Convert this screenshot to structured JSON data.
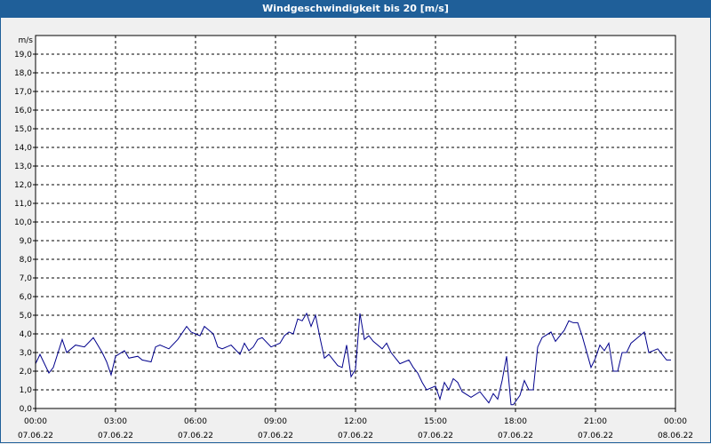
{
  "window": {
    "title": "Windgeschwindigkeit bis 20 [m/s]"
  },
  "chart_data": {
    "type": "line",
    "title": "Windgeschwindigkeit bis 20 [m/s]",
    "ylabel": "m/s",
    "ylim": [
      0,
      20
    ],
    "yticks": [
      "0,0",
      "1,0",
      "2,0",
      "3,0",
      "4,0",
      "5,0",
      "6,0",
      "7,0",
      "8,0",
      "9,0",
      "10,0",
      "11,0",
      "12,0",
      "13,0",
      "14,0",
      "15,0",
      "16,0",
      "17,0",
      "18,0",
      "19,0"
    ],
    "xlim": [
      "07.06.22 00:00",
      "08.06.22 00:00"
    ],
    "xticks": [
      {
        "time": "00:00",
        "date": "07.06.22"
      },
      {
        "time": "03:00",
        "date": "07.06.22"
      },
      {
        "time": "06:00",
        "date": "07.06.22"
      },
      {
        "time": "09:00",
        "date": "07.06.22"
      },
      {
        "time": "12:00",
        "date": "07.06.22"
      },
      {
        "time": "15:00",
        "date": "07.06.22"
      },
      {
        "time": "18:00",
        "date": "07.06.22"
      },
      {
        "time": "21:00",
        "date": "07.06.22"
      },
      {
        "time": "00:00",
        "date": "08.06.22"
      }
    ],
    "grid": true,
    "line_color": "#00008b",
    "series": [
      {
        "x": [
          "00:00",
          "00:10",
          "00:30",
          "00:40",
          "01:00",
          "01:10",
          "01:30",
          "01:50",
          "02:10",
          "02:30",
          "02:40",
          "02:50",
          "03:00",
          "03:20",
          "03:30",
          "03:50",
          "04:00",
          "04:20",
          "04:30",
          "04:40",
          "05:00",
          "05:20",
          "05:40",
          "05:50",
          "06:00",
          "06:10",
          "06:20",
          "06:40",
          "06:50",
          "07:00",
          "07:20",
          "07:40",
          "07:50",
          "08:00",
          "08:10",
          "08:20",
          "08:30",
          "08:50",
          "09:10",
          "09:20",
          "09:30",
          "09:40",
          "09:50",
          "10:00",
          "10:10",
          "10:20",
          "10:30",
          "10:40",
          "10:50",
          "11:00",
          "11:20",
          "11:30",
          "11:40",
          "11:50",
          "12:00",
          "12:10",
          "12:20",
          "12:30",
          "12:40",
          "13:00",
          "13:10",
          "13:20",
          "13:40",
          "14:00",
          "14:10",
          "14:20",
          "14:30",
          "14:40",
          "15:00",
          "15:10",
          "15:20",
          "15:30",
          "15:40",
          "15:50",
          "16:00",
          "16:20",
          "16:40",
          "17:00",
          "17:10",
          "17:20",
          "17:30",
          "17:40",
          "17:50",
          "17:55",
          "18:10",
          "18:20",
          "18:30",
          "18:40",
          "18:50",
          "19:00",
          "19:20",
          "19:30",
          "19:50",
          "20:00",
          "20:10",
          "20:20",
          "20:30",
          "20:50",
          "21:00",
          "21:10",
          "21:20",
          "21:30",
          "21:40",
          "21:50",
          "22:00",
          "22:10",
          "22:20",
          "22:50",
          "23:00",
          "23:10",
          "23:20",
          "23:40",
          "23:50"
        ],
        "y": [
          2.4,
          2.9,
          1.9,
          2.2,
          3.7,
          3.0,
          3.4,
          3.3,
          3.8,
          3.0,
          2.5,
          1.8,
          2.8,
          3.1,
          2.7,
          2.8,
          2.6,
          2.5,
          3.3,
          3.4,
          3.2,
          3.7,
          4.4,
          4.1,
          4.0,
          3.9,
          4.4,
          4.0,
          3.3,
          3.2,
          3.4,
          2.9,
          3.5,
          3.1,
          3.3,
          3.7,
          3.8,
          3.3,
          3.5,
          3.9,
          4.1,
          4.0,
          4.8,
          4.7,
          5.1,
          4.4,
          5.0,
          3.8,
          2.7,
          2.9,
          2.3,
          2.2,
          3.4,
          1.7,
          2.1,
          5.1,
          3.7,
          3.9,
          3.6,
          3.2,
          3.5,
          3.0,
          2.4,
          2.6,
          2.2,
          1.9,
          1.4,
          1.0,
          1.2,
          0.5,
          1.4,
          1.0,
          1.6,
          1.4,
          0.9,
          0.6,
          0.9,
          0.3,
          0.8,
          0.5,
          1.5,
          2.8,
          0.2,
          0.2,
          0.7,
          1.5,
          1.0,
          1.0,
          3.3,
          3.8,
          4.1,
          3.6,
          4.2,
          4.7,
          4.6,
          4.6,
          3.9,
          2.2,
          2.7,
          3.4,
          3.1,
          3.5,
          2.0,
          2.0,
          3.0,
          3.0,
          3.5,
          4.1,
          3.0,
          3.1,
          3.2,
          2.6,
          2.6
        ]
      }
    ]
  }
}
